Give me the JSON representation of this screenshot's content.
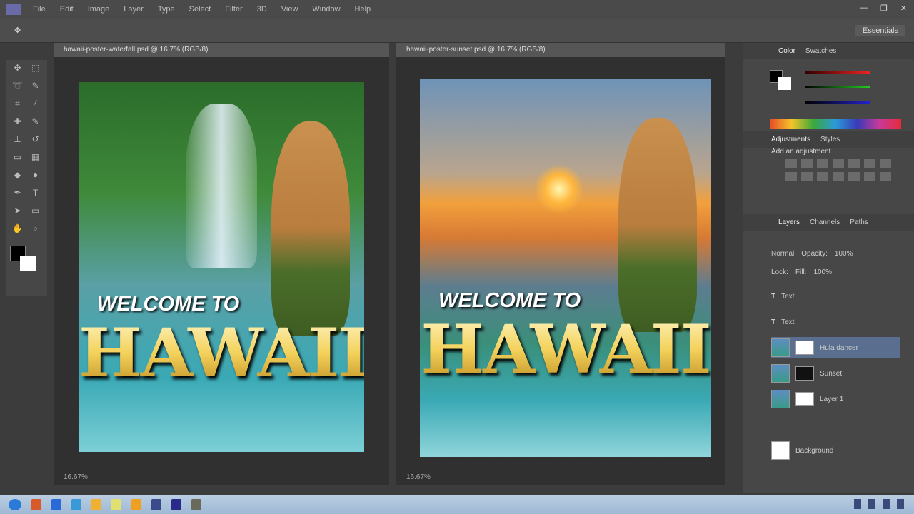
{
  "menubar": {
    "items": [
      "File",
      "Edit",
      "Image",
      "Layer",
      "Type",
      "Select",
      "Filter",
      "3D",
      "View",
      "Window",
      "Help"
    ]
  },
  "window_controls": [
    "—",
    "❐",
    "✕"
  ],
  "options_bar": {
    "workspace": "Essentials"
  },
  "documents": [
    {
      "tab": "hawaii-poster-waterfall.psd @ 16.7% (RGB/8)",
      "status_zoom": "16.67%",
      "poster": {
        "line1": "WELCOME TO",
        "line2": "HAWAII"
      }
    },
    {
      "tab": "hawaii-poster-sunset.psd @ 16.7% (RGB/8)",
      "status_zoom": "16.67%",
      "poster": {
        "line1": "WELCOME TO",
        "line2": "HAWAII"
      }
    }
  ],
  "panels": {
    "color_tabs": [
      "Color",
      "Swatches"
    ],
    "adjust_tabs": [
      "Adjustments",
      "Styles"
    ],
    "adjust_label": "Add an adjustment",
    "layers_tabs": [
      "Layers",
      "Channels",
      "Paths"
    ],
    "blend_mode": "Normal",
    "opacity_label": "Opacity:",
    "opacity": "100%",
    "lock_label": "Lock:",
    "fill_label": "Fill:",
    "fill": "100%",
    "layers": [
      {
        "name": "Text"
      },
      {
        "name": "Text"
      },
      {
        "name": "Hula dancer",
        "selected": true
      },
      {
        "name": "Sunset"
      },
      {
        "name": "Layer 1"
      },
      {
        "name": "Background"
      }
    ]
  }
}
